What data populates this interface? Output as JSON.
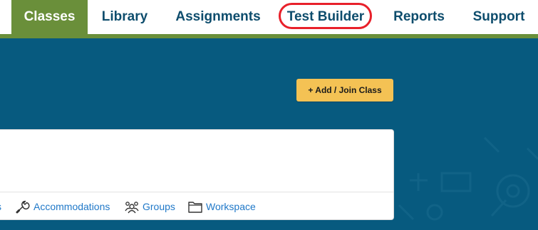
{
  "nav": {
    "tabs": [
      {
        "label": "Classes",
        "active": true
      },
      {
        "label": "Library",
        "active": false
      },
      {
        "label": "Assignments",
        "active": false
      },
      {
        "label": "Test Builder",
        "active": false,
        "highlighted": true
      },
      {
        "label": "Reports",
        "active": false
      },
      {
        "label": "Support",
        "active": false
      }
    ]
  },
  "main": {
    "add_join_label": "+ Add / Join Class"
  },
  "class_card": {
    "links": [
      {
        "label": "s",
        "icon": "truncated"
      },
      {
        "label": "Accommodations",
        "icon": "wrench-icon"
      },
      {
        "label": "Groups",
        "icon": "groups-icon"
      },
      {
        "label": "Workspace",
        "icon": "folder-icon"
      }
    ]
  },
  "colors": {
    "nav_active_bg": "#6a8f3a",
    "nav_text": "#0e4d6d",
    "band_bg": "#075a7f",
    "add_button_bg": "#f4c254",
    "link_color": "#1f78c8",
    "highlight_ring": "#e8202a"
  }
}
